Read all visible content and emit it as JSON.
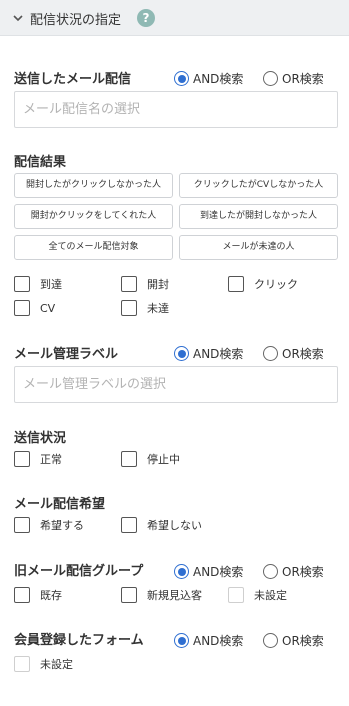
{
  "header": {
    "title": "配信状況の指定",
    "help": "?"
  },
  "delivery": {
    "label": "送信したメール配信",
    "and_label": "AND検索",
    "or_label": "OR検索",
    "placeholder": "メール配信名の選択"
  },
  "result": {
    "label": "配信結果",
    "buttons": [
      "開封したがクリックしなかった人",
      "クリックしたがCVしなかった人",
      "開封かクリックをしてくれた人",
      "到達したが開封しなかった人",
      "全てのメール配信対象",
      "メールが未達の人"
    ],
    "checks": [
      "到達",
      "開封",
      "クリック",
      "CV",
      "未達"
    ]
  },
  "label_section": {
    "label": "メール管理ラベル",
    "and_label": "AND検索",
    "or_label": "OR検索",
    "placeholder": "メール管理ラベルの選択"
  },
  "status": {
    "label": "送信状況",
    "checks": [
      "正常",
      "停止中"
    ]
  },
  "wish": {
    "label": "メール配信希望",
    "checks": [
      "希望する",
      "希望しない"
    ]
  },
  "old_group": {
    "label": "旧メール配信グループ",
    "and_label": "AND検索",
    "or_label": "OR検索",
    "checks": [
      "既存",
      "新規見込客",
      "未設定"
    ]
  },
  "form": {
    "label": "会員登録したフォーム",
    "and_label": "AND検索",
    "or_label": "OR検索",
    "checks": [
      "未設定"
    ]
  },
  "colors": {
    "accent": "#2f6fd1",
    "help": "#8fb9b4",
    "header_bg": "#eef0f2"
  }
}
